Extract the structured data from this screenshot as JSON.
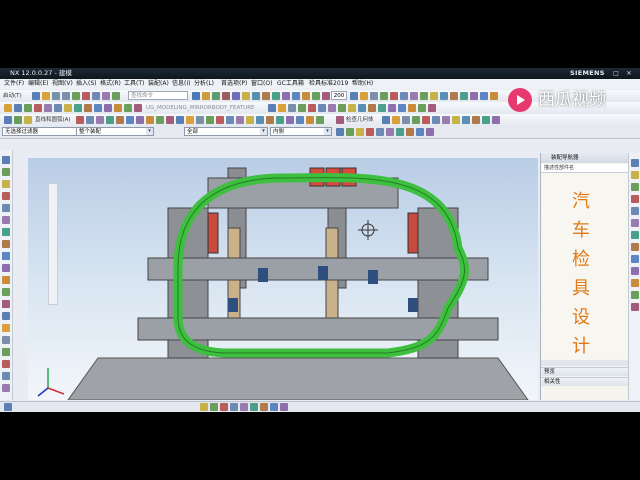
{
  "window": {
    "title": "NX 12.0.0.27 - 建模",
    "brand": "SIEMENS",
    "controls": [
      "–",
      "□",
      "✕"
    ]
  },
  "menubar": {
    "items": [
      "文件(F)",
      "编辑(E)",
      "视图(V)",
      "插入(S)",
      "格式(R)",
      "工具(T)",
      "装配(A)",
      "信息(I)",
      "分析(L)",
      "首选项(P)",
      "窗口(O)",
      "GC工具箱",
      "检具标准2019",
      "帮助(H)"
    ]
  },
  "toolbar": {
    "start_label": "启动(T)",
    "search_placeholder": "查找命令",
    "zoom_value": "200",
    "feature_text": "UG_MODELING_MIRRORBODY_FEATURE",
    "snap_label": "直线和圆弧(A)",
    "check_label": "检查几何体"
  },
  "selection_bar": {
    "filter": "无选择过滤器",
    "scope": "整个装配",
    "layer": "全部",
    "side": "内侧"
  },
  "navigator": {
    "title": "装配导航器",
    "column_header": "描述性部件名",
    "promo_text": [
      "汽",
      "车",
      "检",
      "具",
      "设",
      "计"
    ],
    "sections": [
      "预览",
      "相关性"
    ]
  },
  "watermark": {
    "text": "西瓜视频"
  },
  "colors": {
    "promo_orange": "#e07a18",
    "watermark_pink": "#e63a6e",
    "fixture_gray": "#8a8e93",
    "part_green": "#3fbf3f"
  }
}
